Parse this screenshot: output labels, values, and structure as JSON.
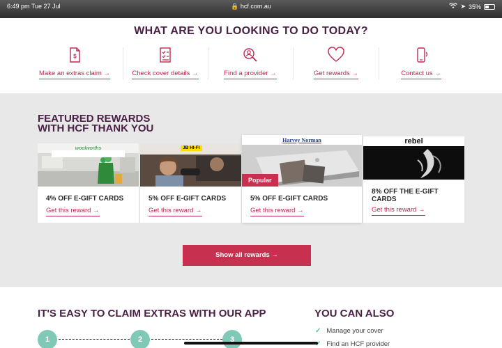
{
  "status_bar": {
    "time": "6:49 pm  Tue 27 Jul",
    "url": "hcf.com.au",
    "battery": "35%"
  },
  "actions": {
    "heading": "WHAT ARE YOU LOOKING TO DO TODAY?",
    "items": [
      {
        "label": "Make an extras claim",
        "icon": "receipt-dollar-icon"
      },
      {
        "label": "Check cover details",
        "icon": "checklist-icon"
      },
      {
        "label": "Find a provider",
        "icon": "search-person-icon"
      },
      {
        "label": "Get rewards",
        "icon": "heart-icon"
      },
      {
        "label": "Contact us",
        "icon": "phone-icon"
      }
    ],
    "arrow": "→"
  },
  "featured": {
    "heading_line1": "FEATURED REWARDS",
    "heading_line2": "WITH HCF THANK YOU",
    "cards": [
      {
        "brand": "woolworths",
        "title": "4% OFF E-GIFT CARDS",
        "link": "Get this reward"
      },
      {
        "brand": "JB HI-FI",
        "title": "5% OFF E-GIFT CARDS",
        "link": "Get this reward"
      },
      {
        "brand": "Harvey Norman",
        "title": "5% OFF E-GIFT CARDS",
        "link": "Get this reward",
        "badge": "Popular"
      },
      {
        "brand": "rebel",
        "title": "8% OFF THE E-GIFT CARDS",
        "link": "Get this reward"
      }
    ],
    "show_all": "Show all rewards →"
  },
  "app_section": {
    "heading": "IT'S EASY TO CLAIM EXTRAS WITH OUR APP",
    "steps": [
      "1",
      "2",
      "3"
    ]
  },
  "also": {
    "heading": "YOU CAN ALSO",
    "items": [
      "Manage your cover",
      "Find an HCF provider"
    ]
  },
  "colors": {
    "brand_plum": "#4a1f45",
    "accent_red": "#c2274d",
    "mint": "#7fc9b6"
  }
}
